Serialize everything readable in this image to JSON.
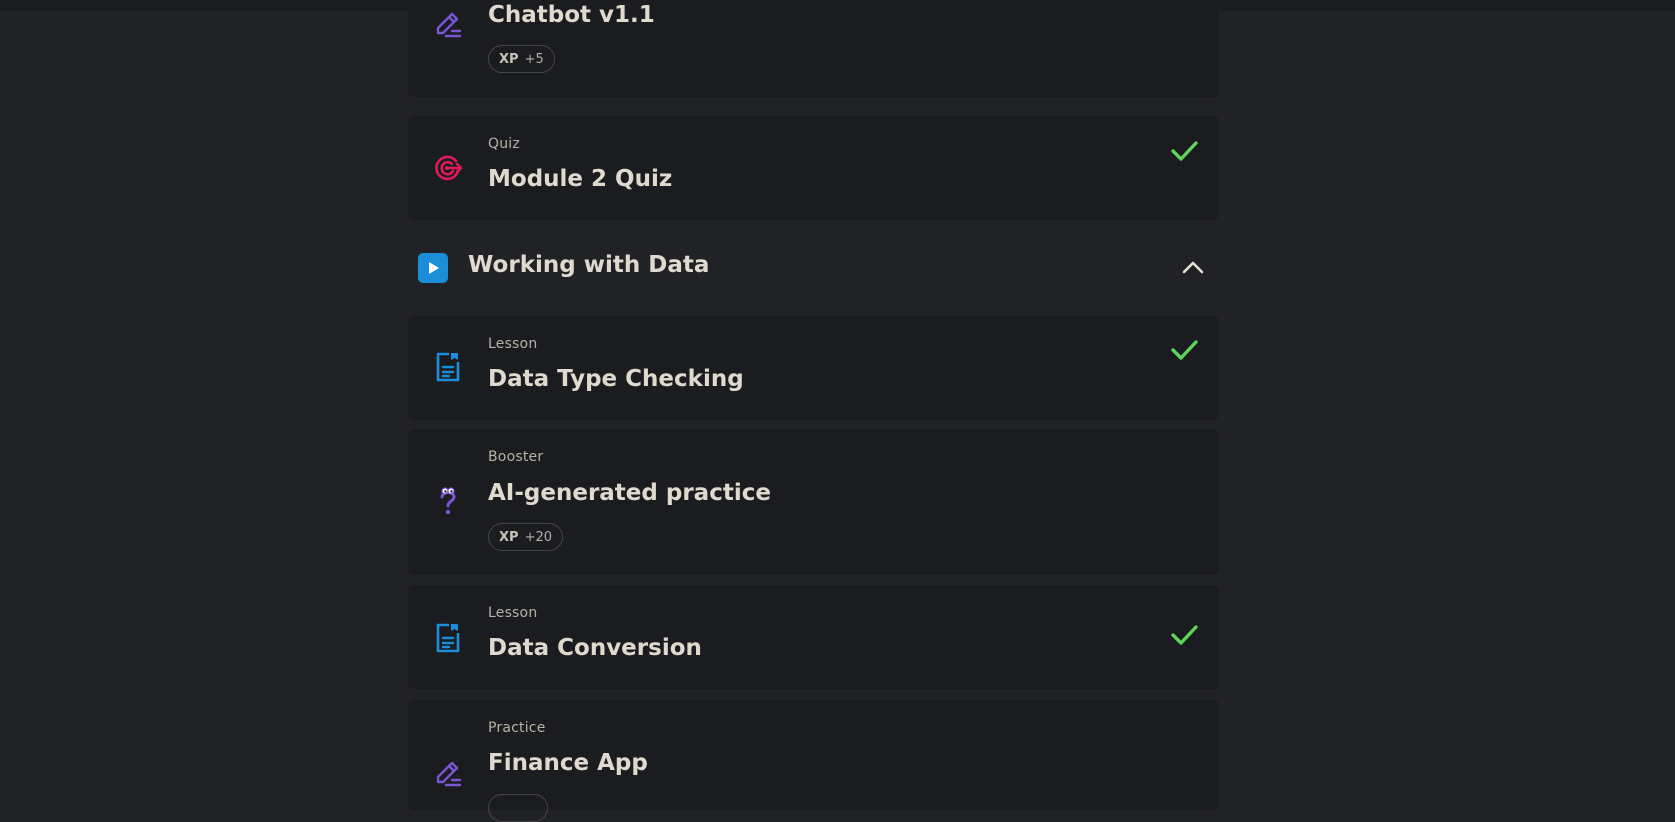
{
  "items_before": [
    {
      "title": "Chatbot v1.1",
      "xp_label": "XP",
      "xp_value": "+5",
      "icon": "pencil-icon",
      "completed": false
    },
    {
      "type": "Quiz",
      "title": "Module 2 Quiz",
      "icon": "target-icon",
      "completed": true
    }
  ],
  "section": {
    "title": "Working with Data",
    "icon": "play-icon",
    "toggle_icon": "chevron-up-icon"
  },
  "items": [
    {
      "type": "Lesson",
      "title": "Data Type Checking",
      "icon": "document-icon",
      "completed": true
    },
    {
      "type": "Booster",
      "title": "AI-generated practice",
      "xp_label": "XP",
      "xp_value": "+20",
      "icon": "question-mark-icon",
      "completed": false
    },
    {
      "type": "Lesson",
      "title": "Data Conversion",
      "icon": "document-icon",
      "completed": true
    },
    {
      "type": "Practice",
      "title": "Finance App",
      "icon": "pencil-icon",
      "completed": false
    }
  ],
  "colors": {
    "background": "#212225",
    "card": "#1b1c1f",
    "check": "#5fd35a",
    "quiz": "#e0195a",
    "lesson": "#1a8ed8",
    "practice": "#7b55d6",
    "play": "#1a8ed8"
  }
}
